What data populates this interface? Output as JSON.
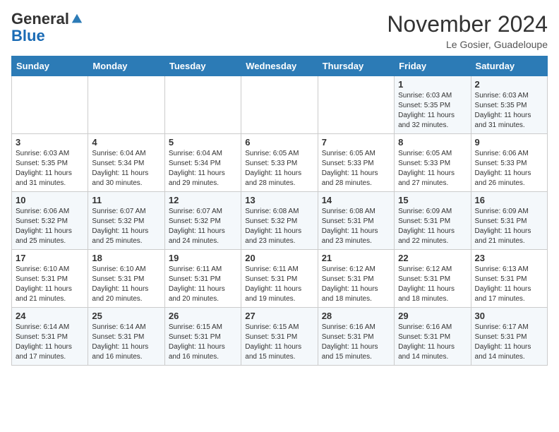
{
  "header": {
    "logo_general": "General",
    "logo_blue": "Blue",
    "month_title": "November 2024",
    "location": "Le Gosier, Guadeloupe"
  },
  "weekdays": [
    "Sunday",
    "Monday",
    "Tuesday",
    "Wednesday",
    "Thursday",
    "Friday",
    "Saturday"
  ],
  "weeks": [
    [
      {
        "day": "",
        "info": ""
      },
      {
        "day": "",
        "info": ""
      },
      {
        "day": "",
        "info": ""
      },
      {
        "day": "",
        "info": ""
      },
      {
        "day": "",
        "info": ""
      },
      {
        "day": "1",
        "info": "Sunrise: 6:03 AM\nSunset: 5:35 PM\nDaylight: 11 hours and 32 minutes."
      },
      {
        "day": "2",
        "info": "Sunrise: 6:03 AM\nSunset: 5:35 PM\nDaylight: 11 hours and 31 minutes."
      }
    ],
    [
      {
        "day": "3",
        "info": "Sunrise: 6:03 AM\nSunset: 5:35 PM\nDaylight: 11 hours and 31 minutes."
      },
      {
        "day": "4",
        "info": "Sunrise: 6:04 AM\nSunset: 5:34 PM\nDaylight: 11 hours and 30 minutes."
      },
      {
        "day": "5",
        "info": "Sunrise: 6:04 AM\nSunset: 5:34 PM\nDaylight: 11 hours and 29 minutes."
      },
      {
        "day": "6",
        "info": "Sunrise: 6:05 AM\nSunset: 5:33 PM\nDaylight: 11 hours and 28 minutes."
      },
      {
        "day": "7",
        "info": "Sunrise: 6:05 AM\nSunset: 5:33 PM\nDaylight: 11 hours and 28 minutes."
      },
      {
        "day": "8",
        "info": "Sunrise: 6:05 AM\nSunset: 5:33 PM\nDaylight: 11 hours and 27 minutes."
      },
      {
        "day": "9",
        "info": "Sunrise: 6:06 AM\nSunset: 5:33 PM\nDaylight: 11 hours and 26 minutes."
      }
    ],
    [
      {
        "day": "10",
        "info": "Sunrise: 6:06 AM\nSunset: 5:32 PM\nDaylight: 11 hours and 25 minutes."
      },
      {
        "day": "11",
        "info": "Sunrise: 6:07 AM\nSunset: 5:32 PM\nDaylight: 11 hours and 25 minutes."
      },
      {
        "day": "12",
        "info": "Sunrise: 6:07 AM\nSunset: 5:32 PM\nDaylight: 11 hours and 24 minutes."
      },
      {
        "day": "13",
        "info": "Sunrise: 6:08 AM\nSunset: 5:32 PM\nDaylight: 11 hours and 23 minutes."
      },
      {
        "day": "14",
        "info": "Sunrise: 6:08 AM\nSunset: 5:31 PM\nDaylight: 11 hours and 23 minutes."
      },
      {
        "day": "15",
        "info": "Sunrise: 6:09 AM\nSunset: 5:31 PM\nDaylight: 11 hours and 22 minutes."
      },
      {
        "day": "16",
        "info": "Sunrise: 6:09 AM\nSunset: 5:31 PM\nDaylight: 11 hours and 21 minutes."
      }
    ],
    [
      {
        "day": "17",
        "info": "Sunrise: 6:10 AM\nSunset: 5:31 PM\nDaylight: 11 hours and 21 minutes."
      },
      {
        "day": "18",
        "info": "Sunrise: 6:10 AM\nSunset: 5:31 PM\nDaylight: 11 hours and 20 minutes."
      },
      {
        "day": "19",
        "info": "Sunrise: 6:11 AM\nSunset: 5:31 PM\nDaylight: 11 hours and 20 minutes."
      },
      {
        "day": "20",
        "info": "Sunrise: 6:11 AM\nSunset: 5:31 PM\nDaylight: 11 hours and 19 minutes."
      },
      {
        "day": "21",
        "info": "Sunrise: 6:12 AM\nSunset: 5:31 PM\nDaylight: 11 hours and 18 minutes."
      },
      {
        "day": "22",
        "info": "Sunrise: 6:12 AM\nSunset: 5:31 PM\nDaylight: 11 hours and 18 minutes."
      },
      {
        "day": "23",
        "info": "Sunrise: 6:13 AM\nSunset: 5:31 PM\nDaylight: 11 hours and 17 minutes."
      }
    ],
    [
      {
        "day": "24",
        "info": "Sunrise: 6:14 AM\nSunset: 5:31 PM\nDaylight: 11 hours and 17 minutes."
      },
      {
        "day": "25",
        "info": "Sunrise: 6:14 AM\nSunset: 5:31 PM\nDaylight: 11 hours and 16 minutes."
      },
      {
        "day": "26",
        "info": "Sunrise: 6:15 AM\nSunset: 5:31 PM\nDaylight: 11 hours and 16 minutes."
      },
      {
        "day": "27",
        "info": "Sunrise: 6:15 AM\nSunset: 5:31 PM\nDaylight: 11 hours and 15 minutes."
      },
      {
        "day": "28",
        "info": "Sunrise: 6:16 AM\nSunset: 5:31 PM\nDaylight: 11 hours and 15 minutes."
      },
      {
        "day": "29",
        "info": "Sunrise: 6:16 AM\nSunset: 5:31 PM\nDaylight: 11 hours and 14 minutes."
      },
      {
        "day": "30",
        "info": "Sunrise: 6:17 AM\nSunset: 5:31 PM\nDaylight: 11 hours and 14 minutes."
      }
    ]
  ]
}
